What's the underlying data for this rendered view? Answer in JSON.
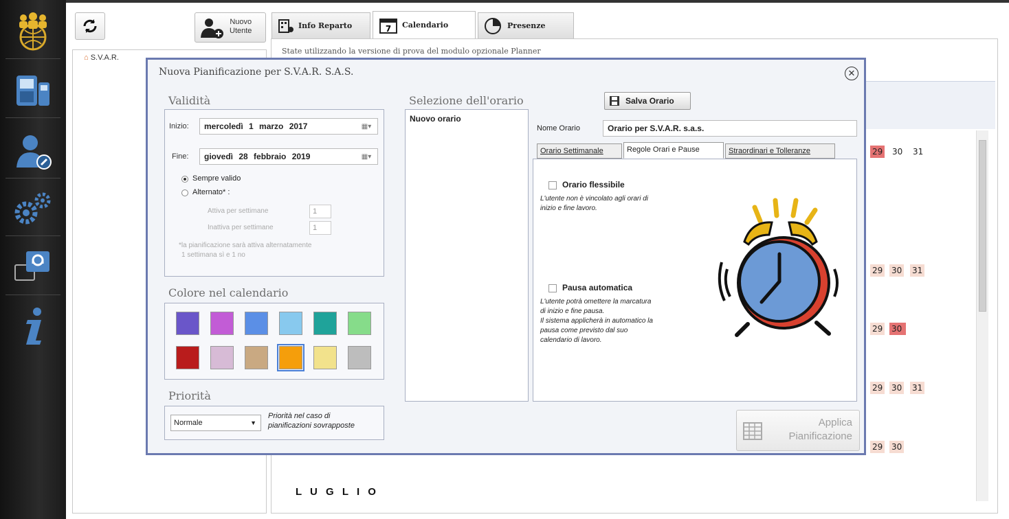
{
  "sidebar": {
    "icons": [
      "team-globe-icon",
      "terminal-devices-icon",
      "user-key-icon",
      "settings-gears-icon",
      "support-chat-icon",
      "info-icon"
    ]
  },
  "toolbar": {
    "new_user_line1": "Nuovo",
    "new_user_line2": "Utente"
  },
  "tree": {
    "root_label": "S.V.A.R."
  },
  "tabs": [
    {
      "label": "Info Reparto"
    },
    {
      "label": "Calendario",
      "active": true
    },
    {
      "label": "Presenze"
    }
  ],
  "calendar_day_icon": "7",
  "notice": "State utilizzando la versione di prova del modulo opzionale Planner",
  "calendar": {
    "rows": [
      {
        "days": [
          "29",
          "30",
          "31"
        ],
        "highlight": [
          true,
          false,
          false
        ],
        "red": [
          true,
          false,
          false
        ]
      },
      {
        "days": [
          "29",
          "30",
          "31"
        ],
        "highlight": [
          true,
          true,
          true
        ],
        "red": [
          false,
          false,
          false
        ]
      },
      {
        "days": [
          "29",
          "30"
        ],
        "highlight": [
          true,
          true
        ],
        "red": [
          false,
          true
        ]
      },
      {
        "days": [
          "29",
          "30",
          "31"
        ],
        "highlight": [
          true,
          true,
          true
        ],
        "red": [
          false,
          false,
          false
        ]
      },
      {
        "days": [
          "29",
          "30"
        ],
        "highlight": [
          true,
          true
        ],
        "red": [
          false,
          false
        ]
      }
    ],
    "month_label": "L U G L I O"
  },
  "dialog": {
    "title": "Nuova Pianificazione per S.V.A.R. S.A.S.",
    "validity": {
      "title": "Validità",
      "start_label": "Inizio:",
      "start_value": "mercoledì 1 marzo 2017",
      "end_label": "Fine:",
      "end_value": "giovedì 28 febbraio 2019",
      "always_valid": "Sempre valido",
      "alternated": "Alternato* :",
      "active_weeks_label": "Attiva per settimane",
      "active_weeks_value": "1",
      "inactive_weeks_label": "Inattiva per settimane",
      "inactive_weeks_value": "1",
      "note_line1": "*la pianificazione sarà attiva alternatamente",
      "note_line2": "1 settimana sì e 1 no"
    },
    "color": {
      "title": "Colore nel calendario",
      "swatches": [
        "#6a56c9",
        "#c25cd6",
        "#5b8fe6",
        "#88c9ee",
        "#1fa39a",
        "#86dc8a",
        "#b91c1c",
        "#d7bbd6",
        "#c9a982",
        "#f59e0b",
        "#f2e28c",
        "#bdbdbd"
      ],
      "selected_index": 9
    },
    "priority": {
      "title": "Priorità",
      "value": "Normale",
      "hint_line1": "Priorità nel caso di",
      "hint_line2": "pianificazioni sovrapposte"
    },
    "schedule": {
      "title": "Selezione dell'orario",
      "list": [
        "Nuovo orario"
      ],
      "save_label": "Salva Orario",
      "name_label": "Nome Orario",
      "name_value": "Orario per S.V.A.R. s.a.s.",
      "tabs": [
        "Orario Settimanale",
        "Regole Orari e Pause",
        "Straordinari e Tolleranze"
      ],
      "active_tab": 1,
      "flex_label": "Orario flessibile",
      "flex_desc_1": "L'utente non è vincolato agli orari di",
      "flex_desc_2": "inizio e fine lavoro.",
      "pause_label": "Pausa automatica",
      "pause_desc": [
        "L'utente potrà omettere la marcatura",
        "di inizio e fine pausa.",
        "Il sistema applicherà in automatico la",
        "pausa come previsto dal suo",
        "calendario di lavoro."
      ]
    },
    "apply_line1": "Applica",
    "apply_line2": "Pianificazione"
  }
}
